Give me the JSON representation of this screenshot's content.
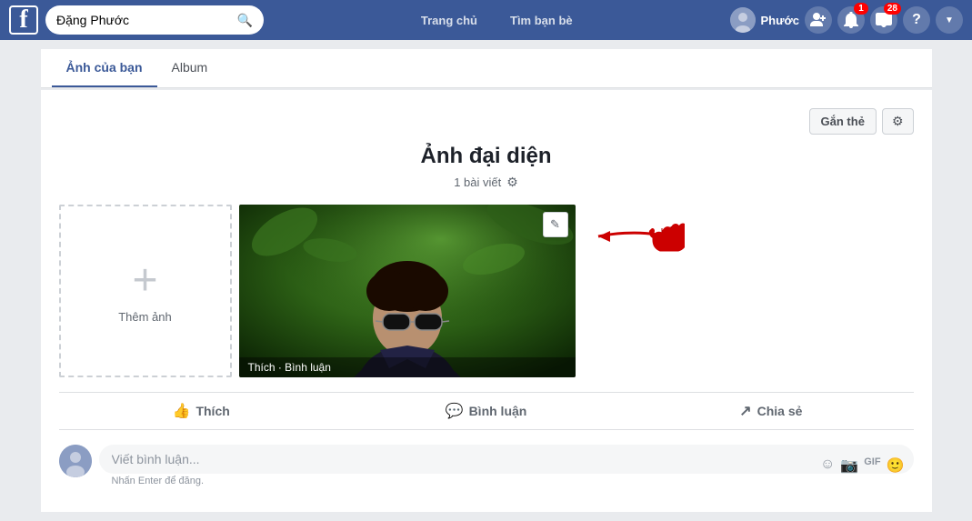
{
  "navbar": {
    "logo": "f",
    "search_placeholder": "Đặng Phước",
    "user_name": "Phước",
    "nav_links": [
      "Trang chủ",
      "Tìm bạn bè"
    ],
    "friend_requests_badge": "",
    "notifications_badge": "1",
    "messages_badge": "28"
  },
  "sub_tabs": {
    "tabs": [
      {
        "label": "Ảnh của bạn",
        "active": true
      },
      {
        "label": "Album",
        "active": false
      }
    ]
  },
  "album": {
    "title": "Ảnh đại diện",
    "post_count": "1 bài viết",
    "tag_button": "Gắn thẻ",
    "add_photo_label": "Thêm ảnh",
    "photo_bar": "Thích · Bình luận",
    "edit_icon": "✎"
  },
  "reactions": {
    "like_label": "Thích",
    "comment_label": "Bình luận",
    "share_label": "Chia sẻ"
  },
  "comment_area": {
    "placeholder": "Viết bình luận...",
    "enter_hint": "Nhấn Enter để đăng.",
    "emoji_icon": "☺",
    "camera_icon": "📷",
    "gif_icon": "GIF",
    "sticker_icon": "🙂"
  }
}
